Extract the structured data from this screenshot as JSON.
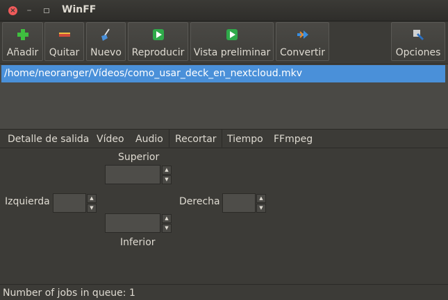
{
  "window": {
    "title": "WinFF"
  },
  "toolbar": {
    "add": "Añadir",
    "remove": "Quitar",
    "new": "Nuevo",
    "play": "Reproducir",
    "preview": "Vista preliminar",
    "convert": "Convertir",
    "options": "Opciones"
  },
  "files": [
    "/home/neoranger/Vídeos/como_usar_deck_en_nextcloud.mkv"
  ],
  "tabs": [
    "Detalle de salida",
    "Vídeo",
    "Audio",
    "Recortar",
    "Tiempo",
    "FFmpeg"
  ],
  "active_tab": "Recortar",
  "crop": {
    "top_label": "Superior",
    "left_label": "Izquierda",
    "right_label": "Derecha",
    "bottom_label": "Inferior",
    "top_value": "",
    "left_value": "",
    "right_value": "",
    "bottom_value": ""
  },
  "status": {
    "text": "Number of jobs in queue: 1"
  },
  "colors": {
    "selection": "#4a90d9",
    "close": "#f05a5a",
    "add": "#3fbf3f",
    "remove": "#d04a3a",
    "play": "#2faa4a"
  }
}
